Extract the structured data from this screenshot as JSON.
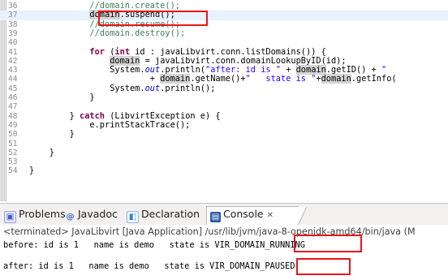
{
  "editor": {
    "lines": [
      {
        "num": "36",
        "code": "            //domain.create();",
        "cls": "cm"
      },
      {
        "num": "37",
        "current": true,
        "parts": [
          {
            "t": "            "
          },
          {
            "t": "domain",
            "c": "hl"
          },
          {
            "t": ".suspend();"
          }
        ]
      },
      {
        "num": "38",
        "code": "            //domain.resume();",
        "cls": "cm"
      },
      {
        "num": "39",
        "code": "            //domain.destroy();",
        "cls": "cm"
      },
      {
        "num": "40",
        "code": ""
      },
      {
        "num": "41",
        "parts": [
          {
            "t": "            "
          },
          {
            "t": "for",
            "c": "kw"
          },
          {
            "t": " ("
          },
          {
            "t": "int",
            "c": "kw"
          },
          {
            "t": " id : javaLibvirt.conn.listDomains()) {"
          }
        ]
      },
      {
        "num": "42",
        "parts": [
          {
            "t": "                "
          },
          {
            "t": "domain",
            "c": "hl"
          },
          {
            "t": " = javaLibvirt.conn.domainLookupByID(id);"
          }
        ]
      },
      {
        "num": "43",
        "parts": [
          {
            "t": "                System."
          },
          {
            "t": "out",
            "c": "st"
          },
          {
            "t": ".println("
          },
          {
            "t": "\"after: id is \"",
            "c": "str"
          },
          {
            "t": " + "
          },
          {
            "t": "domain",
            "c": "hl"
          },
          {
            "t": ".getID() + "
          },
          {
            "t": "\"",
            "c": "str"
          }
        ]
      },
      {
        "num": "44",
        "parts": [
          {
            "t": "                        + "
          },
          {
            "t": "domain",
            "c": "hl"
          },
          {
            "t": ".getName()+"
          },
          {
            "t": "\"   state is \"",
            "c": "str"
          },
          {
            "t": "+"
          },
          {
            "t": "domain",
            "c": "hl"
          },
          {
            "t": ".getInfo("
          }
        ]
      },
      {
        "num": "45",
        "parts": [
          {
            "t": "                System."
          },
          {
            "t": "out",
            "c": "st"
          },
          {
            "t": ".println();"
          }
        ]
      },
      {
        "num": "46",
        "code": "            }"
      },
      {
        "num": "47",
        "code": ""
      },
      {
        "num": "48",
        "parts": [
          {
            "t": "        } "
          },
          {
            "t": "catch",
            "c": "kw"
          },
          {
            "t": " (LibvirtException e) {"
          }
        ]
      },
      {
        "num": "49",
        "code": "            e.printStackTrace();"
      },
      {
        "num": "50",
        "code": "        }"
      },
      {
        "num": "51",
        "code": ""
      },
      {
        "num": "52",
        "code": "    }"
      },
      {
        "num": "53",
        "code": ""
      },
      {
        "num": "54",
        "code": "}"
      }
    ]
  },
  "tabs": [
    {
      "label": "Problems",
      "icon": "problems-icon"
    },
    {
      "label": "Javadoc",
      "icon": "javadoc-icon"
    },
    {
      "label": "Declaration",
      "icon": "declaration-icon"
    },
    {
      "label": "Console",
      "icon": "console-icon",
      "active": true,
      "close": "✕"
    }
  ],
  "console": {
    "terminated": "<terminated> JavaLibvirt [Java Application] /usr/lib/jvm/java-8-openjdk-amd64/bin/java (M",
    "line1": "before: id is 1   name is demo   state is VIR_DOMAIN_RUNNING",
    "line2": "after: id is 1   name is demo   state is VIR_DOMAIN_PAUSED"
  },
  "colors": {
    "highlight_box": "#e8161c",
    "comment": "#3f7f5f",
    "keyword": "#7f0055",
    "string": "#2a00ff"
  }
}
